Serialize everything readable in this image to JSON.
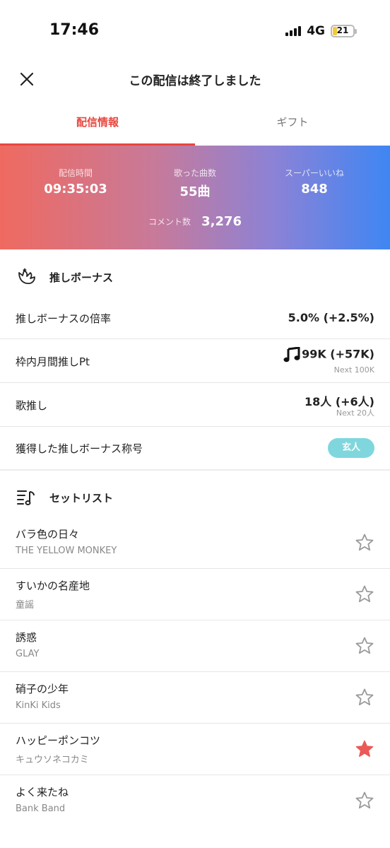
{
  "status_bar": {
    "time": "17:46",
    "network": "4G",
    "battery": "21"
  },
  "header": {
    "title": "この配信は終了しました"
  },
  "tabs": [
    {
      "label": "配信情報",
      "active": true
    },
    {
      "label": "ギフト",
      "active": false
    }
  ],
  "stats": {
    "duration_label": "配信時間",
    "duration": "09:35:03",
    "songs_label": "歌った曲数",
    "songs": "55曲",
    "super_like_label": "スーパーいいね",
    "super_like": "848",
    "comments_label": "コメント数",
    "comments": "3,276"
  },
  "bonus": {
    "title": "推しボーナス",
    "rate_label": "推しボーナスの倍率",
    "rate_value": "5.0% (+2.5%)",
    "monthly_label": "枠内月間推しPt",
    "monthly_value": "99K (+57K)",
    "monthly_next": "Next 100K",
    "song_push_label": "歌推し",
    "song_push_value": "18人 (+6人)",
    "song_push_next": "Next 20人",
    "title_label": "獲得した推しボーナス称号",
    "title_badge": "玄人"
  },
  "setlist": {
    "title": "セットリスト",
    "songs": [
      {
        "title": "バラ色の日々",
        "artist": "THE YELLOW MONKEY",
        "favorite": false
      },
      {
        "title": "すいかの名産地",
        "artist": "童謡",
        "favorite": false
      },
      {
        "title": "誘惑",
        "artist": "GLAY",
        "favorite": false
      },
      {
        "title": "硝子の少年",
        "artist": "KinKi Kids",
        "favorite": false
      },
      {
        "title": "ハッピーポンコツ",
        "artist": "キュウソネコカミ",
        "favorite": true
      },
      {
        "title": "よく来たね",
        "artist": "Bank Band",
        "favorite": false
      }
    ]
  },
  "colors": {
    "accent": "#e8463f",
    "badge": "#7fd7dd",
    "star_filled": "#ea5a57",
    "star_empty": "#9a9a9a"
  }
}
